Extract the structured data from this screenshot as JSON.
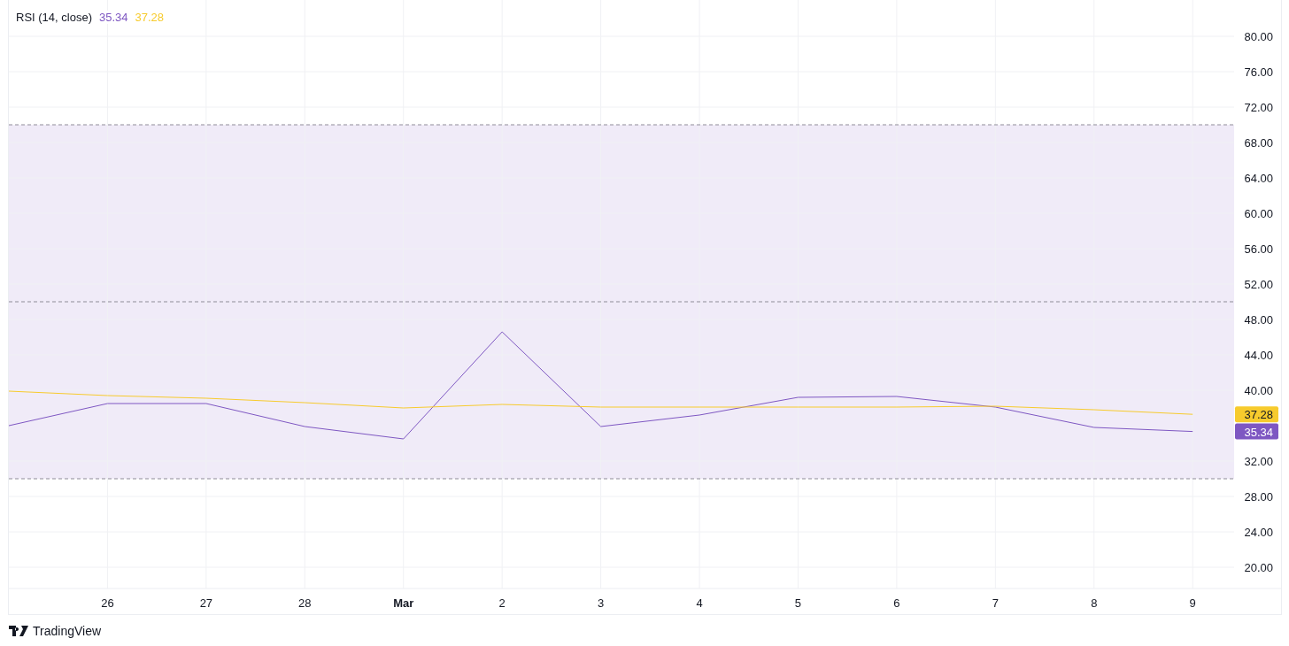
{
  "legend": {
    "title": "RSI (14, close)",
    "values": [
      {
        "text": "35.34",
        "color": "#7e57c2"
      },
      {
        "text": "37.28",
        "color": "#f7cb2d"
      }
    ]
  },
  "chart_data": {
    "type": "line",
    "categories": [
      null,
      "26",
      "27",
      "28",
      "Mar",
      "2",
      "3",
      "4",
      "5",
      "6",
      "7",
      "8",
      "9"
    ],
    "ylim": [
      17.6,
      84.1
    ],
    "yticks": [
      {
        "value": 80,
        "label": "80.00"
      },
      {
        "value": 76,
        "label": "76.00"
      },
      {
        "value": 72,
        "label": "72.00"
      },
      {
        "value": 68,
        "label": "68.00"
      },
      {
        "value": 64,
        "label": "64.00"
      },
      {
        "value": 60,
        "label": "60.00"
      },
      {
        "value": 56,
        "label": "56.00"
      },
      {
        "value": 52,
        "label": "52.00"
      },
      {
        "value": 48,
        "label": "48.00"
      },
      {
        "value": 44,
        "label": "44.00"
      },
      {
        "value": 40,
        "label": "40.00"
      },
      {
        "value": 32,
        "label": "32.00"
      },
      {
        "value": 28,
        "label": "28.00"
      },
      {
        "value": 24,
        "label": "24.00"
      },
      {
        "value": 20,
        "label": "20.00"
      }
    ],
    "grid": true,
    "series": [
      {
        "color": "#7e57c2",
        "values": [
          36.0,
          38.5,
          38.5,
          35.9,
          34.5,
          46.6,
          35.9,
          37.2,
          39.2,
          39.3,
          38.1,
          35.8,
          35.34
        ]
      },
      {
        "color": "#f7cb2d",
        "values": [
          39.9,
          39.4,
          39.1,
          38.6,
          38.0,
          38.4,
          38.1,
          38.1,
          38.1,
          38.1,
          38.2,
          37.8,
          37.28
        ]
      }
    ],
    "bands": [
      {
        "axis": "y",
        "from": 30,
        "to": 70,
        "color": "#f0ebf8"
      }
    ],
    "ref_lines": [
      {
        "axis": "y",
        "value": 70,
        "color": "#8f8d98"
      },
      {
        "axis": "y",
        "value": 50,
        "color": "#8f8d98"
      },
      {
        "axis": "y",
        "value": 30,
        "color": "#8f8d98"
      }
    ],
    "value_labels": [
      "35.34",
      "37.28"
    ]
  },
  "x_axis_style": {
    "bold_labels": [
      false,
      false,
      false,
      true,
      false,
      false,
      false,
      false,
      false,
      false,
      false,
      false
    ]
  },
  "footer": {
    "brand": "TradingView"
  }
}
